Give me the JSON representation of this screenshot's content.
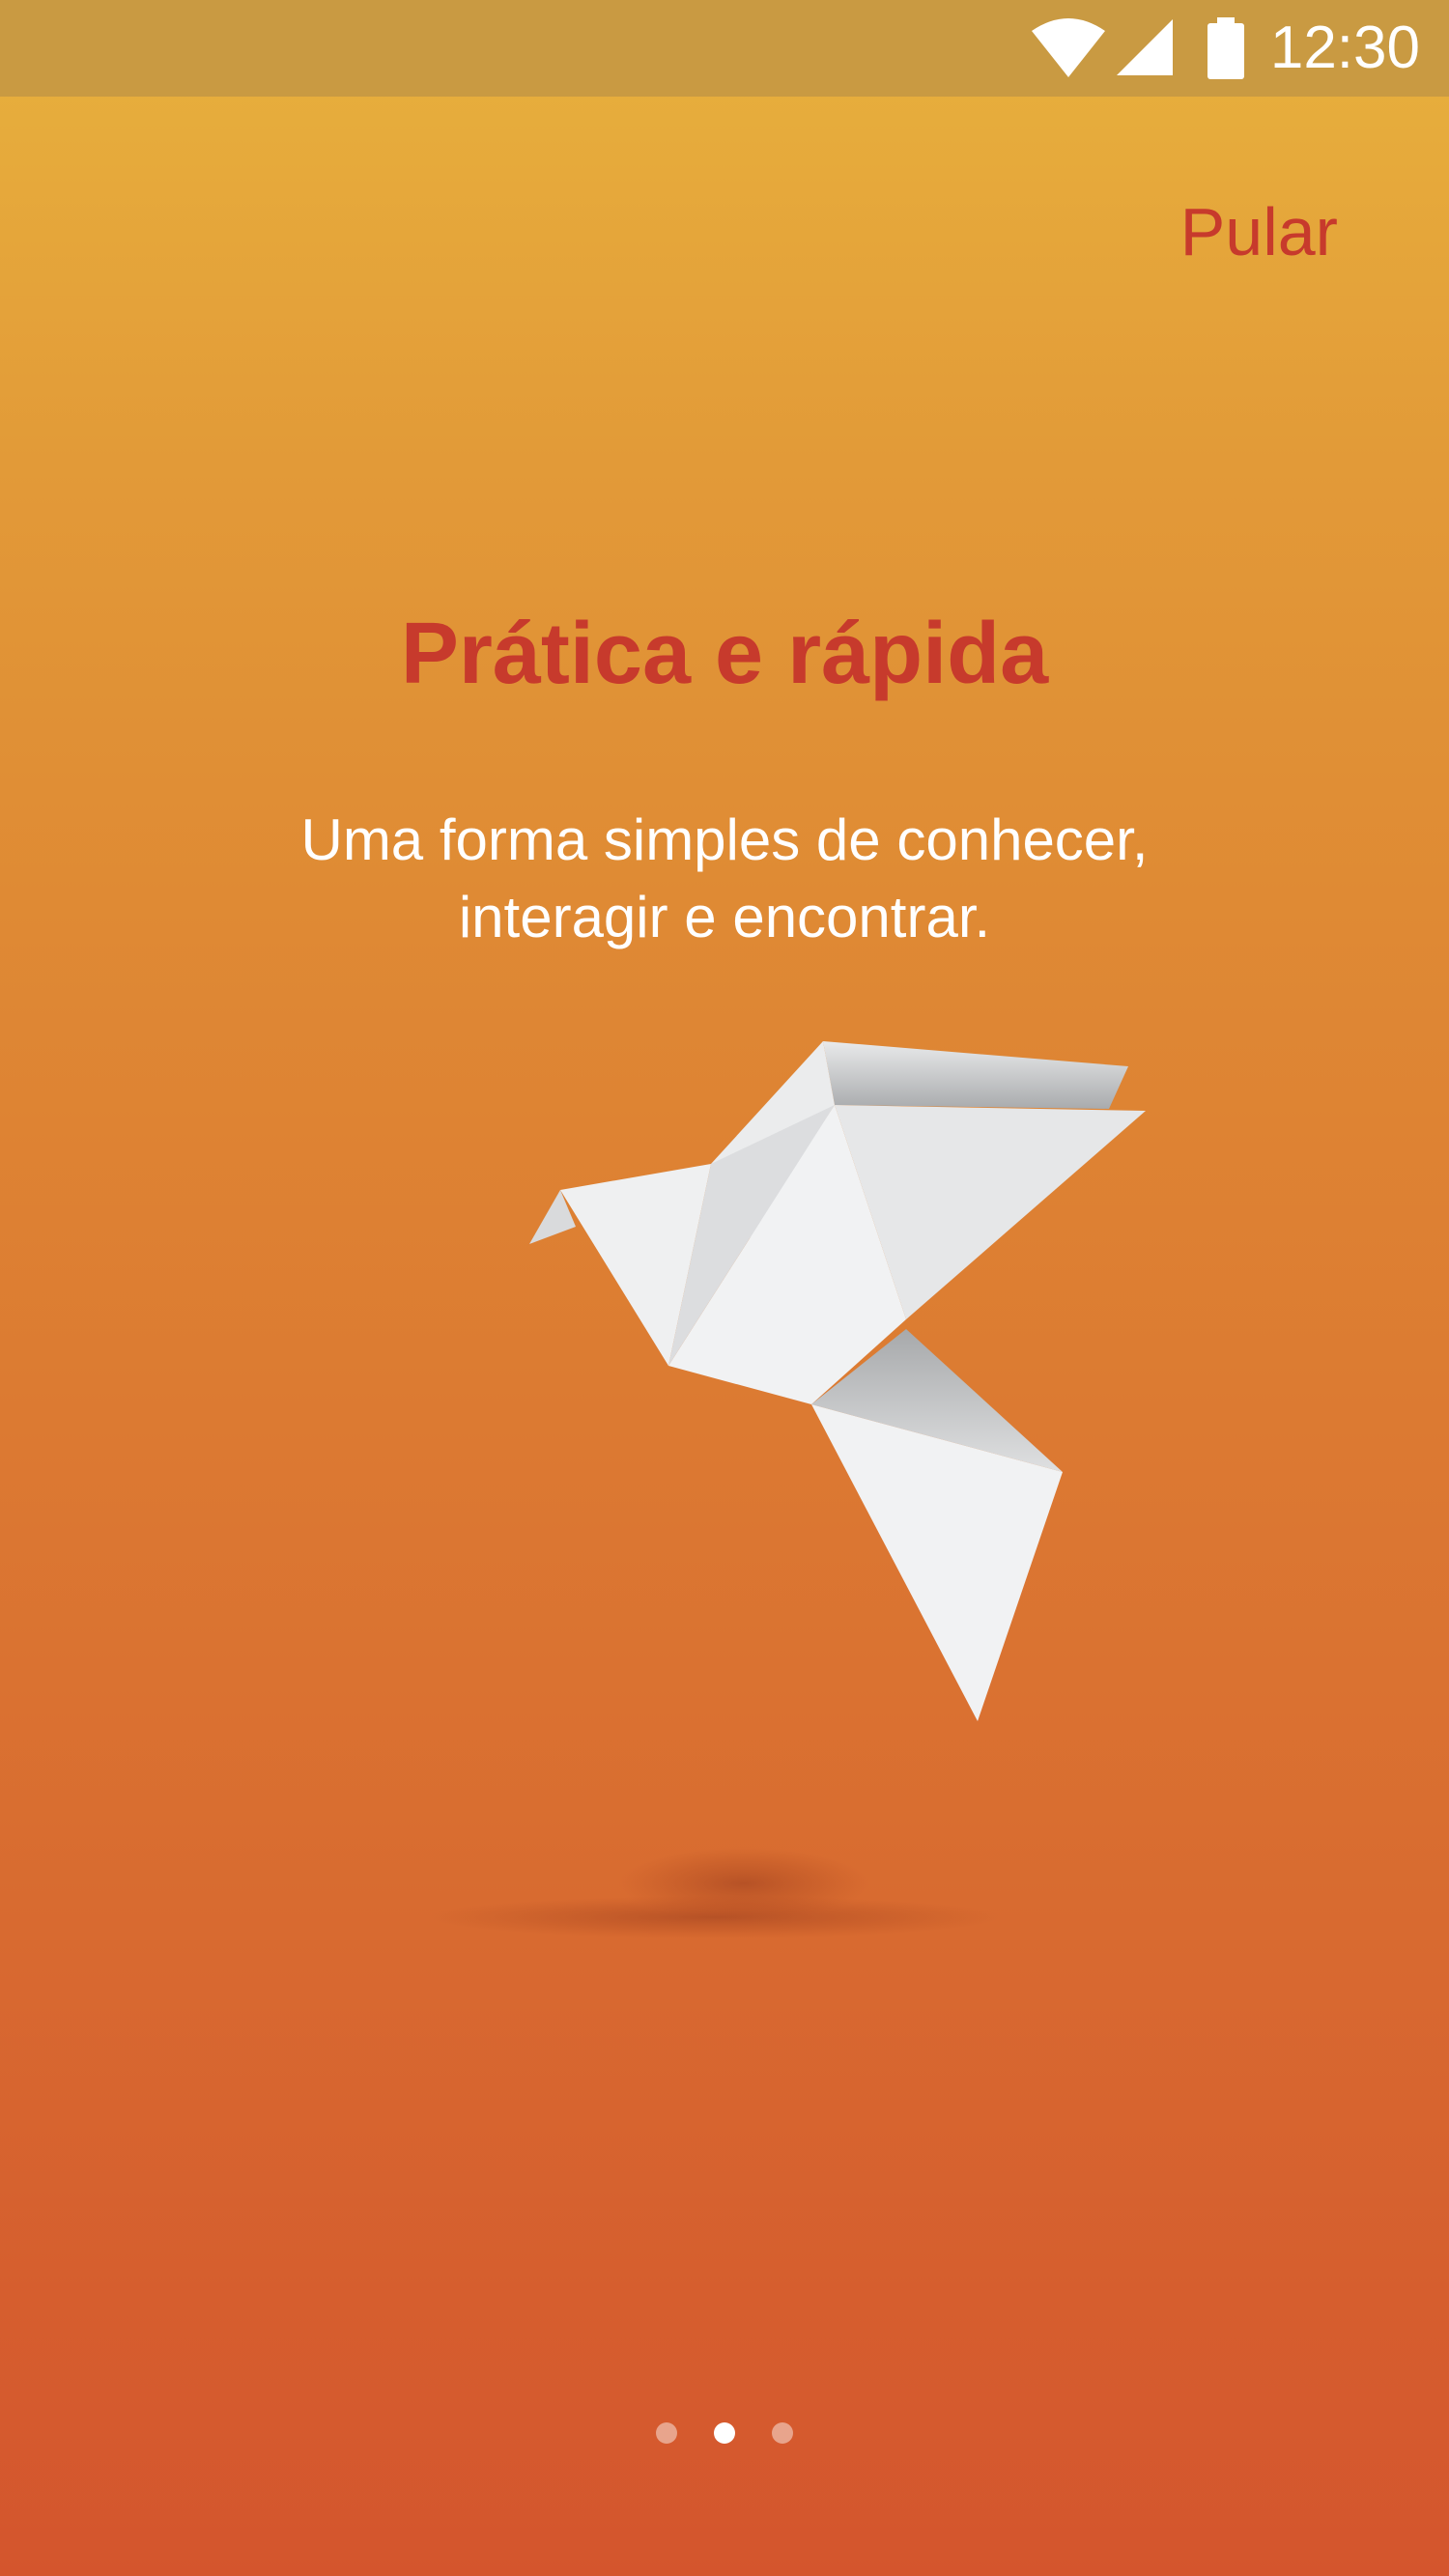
{
  "status_bar": {
    "time": "12:30",
    "icons": [
      "wifi-icon",
      "signal-icon",
      "battery-icon"
    ]
  },
  "onboarding": {
    "skip_label": "Pular",
    "title": "Prática e rápida",
    "subtitle_line1": "Uma forma simples de conhecer,",
    "subtitle_line2": "interagir e encontrar.",
    "illustration": "origami-bird",
    "pager": {
      "count": 3,
      "active_index": 1
    }
  },
  "colors": {
    "accent": "#c73a2c",
    "status_bar": "#c99a42",
    "gradient_top": "#e8b23d",
    "gradient_bottom": "#d4552d"
  }
}
